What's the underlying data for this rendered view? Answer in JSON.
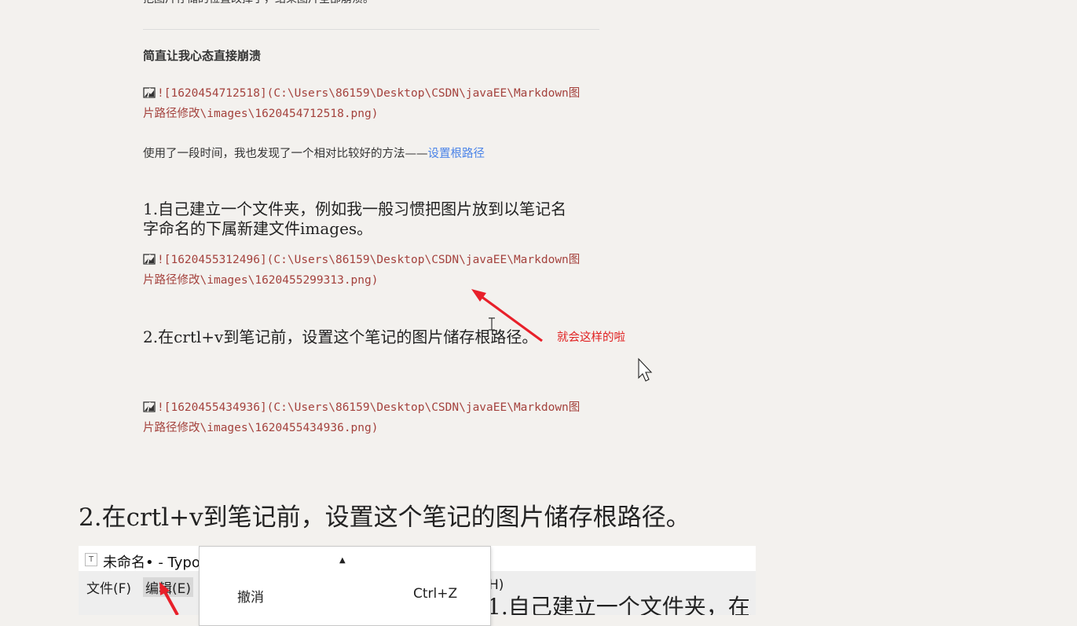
{
  "article": {
    "top_partial_text": "把图片存储的位置改掉了，结果图片全部崩溃。",
    "subheading": "简直让我心态直接崩溃",
    "image1": {
      "line1": "![1620454712518](C:\\Users\\86159\\Desktop\\CSDN\\javaEE\\Markdown图",
      "line2": "片路径修改\\images\\1620454712518.png)"
    },
    "paragraph_text": "使用了一段时间，我也发现了一个相对比较好的方法——",
    "paragraph_link": "设置根路径",
    "step1": {
      "line1": "1.自己建立一个文件夹，例如我一般习惯把图片放到以笔记名",
      "line2": "字命名的下属新建文件images。"
    },
    "image2": {
      "line1": "![1620455312496](C:\\Users\\86159\\Desktop\\CSDN\\javaEE\\Markdown图",
      "line2": "片路径修改\\images\\1620455299313.png)"
    },
    "step2": "2.在crtl+v到笔记前，设置这个笔记的图片储存根路径。",
    "annotation": "就会这样的啦",
    "image3": {
      "line1": "![1620455434936](C:\\Users\\86159\\Desktop\\CSDN\\javaEE\\Markdown图",
      "line2": "片路径修改\\images\\1620455434936.png)"
    },
    "big_heading": "2.在crtl+v到笔记前，设置这个笔记的图片储存根路径。"
  },
  "embedded_screenshot": {
    "window_title": "未命名• - Typo",
    "app_icon_letter": "T",
    "menu_file": "文件(F)",
    "menu_edit": "编辑(E)",
    "menu_partial": "H)",
    "background_text": "1.自己建立一个文件夹，在",
    "dropdown": {
      "scroll_up": "▲",
      "item_label": "撤消",
      "item_shortcut": "Ctrl+Z"
    }
  },
  "colors": {
    "background": "#f3f1ee",
    "code_text": "#a4423d",
    "link": "#4a83e8",
    "annotation": "#e02020"
  },
  "icons": [
    "broken-image-icon",
    "red-arrow-icon",
    "text-cursor-icon",
    "mouse-pointer-icon",
    "scroll-up-icon"
  ]
}
